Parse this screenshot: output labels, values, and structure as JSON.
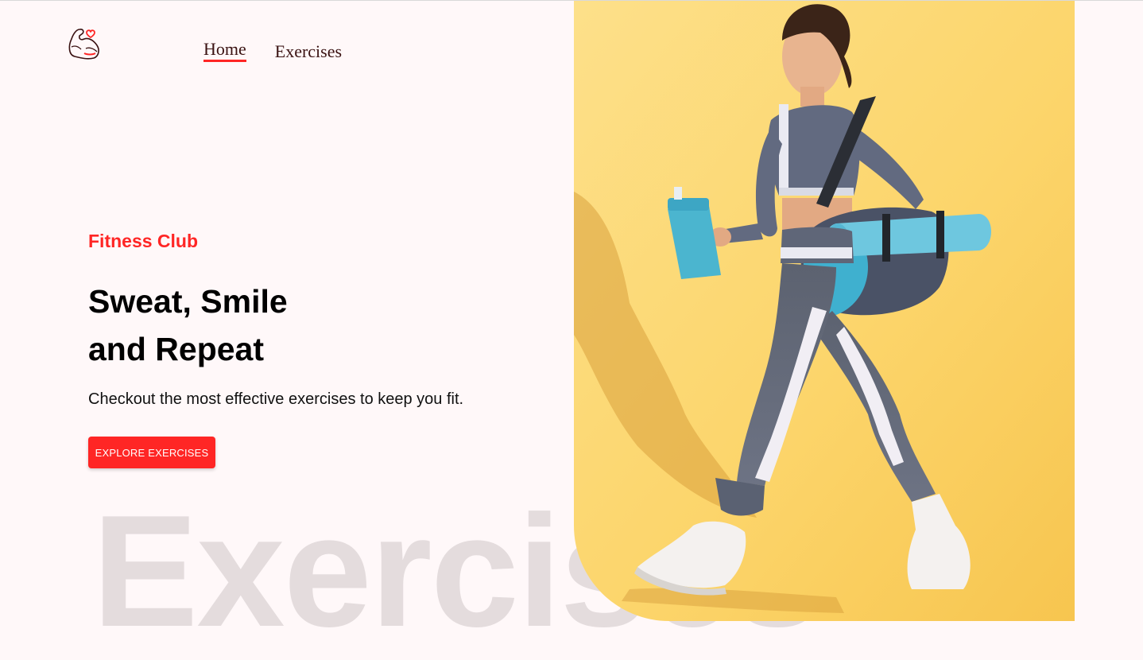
{
  "nav": {
    "links": [
      {
        "label": "Home",
        "active": true
      },
      {
        "label": "Exercises",
        "active": false
      }
    ]
  },
  "hero": {
    "eyebrow": "Fitness Club",
    "headline_line1": "Sweat, Smile",
    "headline_line2": "and Repeat",
    "subtext": "Checkout the most effective exercises to keep you fit.",
    "cta_label": "EXPLORE EXERCISES",
    "watermark": "Exercises"
  },
  "colors": {
    "accent": "#ff2625",
    "background": "#fff8f9",
    "hero_bg": "#fcd874"
  },
  "icons": {
    "logo": "flexed-arm-heart-icon"
  }
}
